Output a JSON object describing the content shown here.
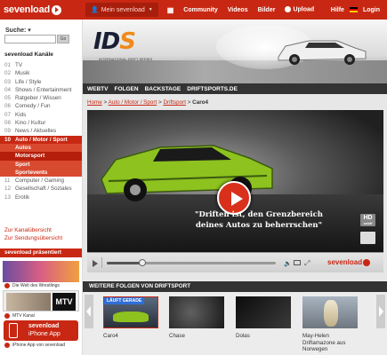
{
  "brand": {
    "name": "sevenload",
    "accent": "#c82813"
  },
  "topnav": {
    "mein": "Mein sevenload",
    "items": [
      "Community",
      "Videos",
      "Bilder"
    ],
    "upload": "Upload",
    "hilfe": "Hilfe",
    "login": "Login"
  },
  "sidebar": {
    "search_label": "Suche",
    "search_value": "",
    "search_button": "Go",
    "kanaele_title": "sevenload Kanäle",
    "categories": [
      {
        "num": "01",
        "label": "TV"
      },
      {
        "num": "02",
        "label": "Musik"
      },
      {
        "num": "03",
        "label": "Life / Style"
      },
      {
        "num": "04",
        "label": "Shows / Entertainment"
      },
      {
        "num": "05",
        "label": "Ratgeber / Wissen"
      },
      {
        "num": "06",
        "label": "Comedy / Fun"
      },
      {
        "num": "07",
        "label": "Kids"
      },
      {
        "num": "08",
        "label": "Kino / Kultur"
      },
      {
        "num": "09",
        "label": "News / Aktuelles"
      },
      {
        "num": "10",
        "label": "Auto / Motor / Sport"
      }
    ],
    "subcategories": [
      "Autos",
      "Motorsport",
      "Sport",
      "Sportevents"
    ],
    "categories2": [
      {
        "num": "11",
        "label": "Computer / Gaming"
      },
      {
        "num": "12",
        "label": "Gesellschaft / Soziales"
      },
      {
        "num": "13",
        "label": "Erotik"
      }
    ],
    "links": [
      "Zur Kanalübersicht",
      "Zur Sendungsübersicht"
    ],
    "praesentiert": "sevenload präsentiert",
    "promo1_caption": "Die Welt des Wrestlings",
    "promo2_logo": "MTV",
    "promo2_caption": "MTV Kanal",
    "iphone_line1": "sevenload",
    "iphone_line2": "iPhone App",
    "iphone_caption": "iPhone App von sevenload"
  },
  "banner": {
    "logo_main": "ID",
    "logo_accent": "S",
    "logo_sub": "INTERNATIONAL DRIFT SERIES"
  },
  "subnav": [
    "WEBTV",
    "FOLGEN",
    "BACKSTAGE",
    "DRIFTSPORTS.DE"
  ],
  "breadcrumb": {
    "items": [
      "Home",
      "Auto / Motor / Sport",
      "Driftsport"
    ],
    "current": "Caro4",
    "sep": ">"
  },
  "player": {
    "quote_line1": "\"Driften ist, den Grenzbereich",
    "quote_line2": "deines Autos zu beherrschen\"",
    "hd_label": "HD",
    "hd_sub": "on/off",
    "cc_label": "",
    "progress_loaded": 0.2,
    "logo": "sevenload"
  },
  "more": {
    "title": "WEITERE FOLGEN VON DRIFTSPORT",
    "live_badge": "LÄUFT GERADE",
    "episodes": [
      "Caro4",
      "Chase",
      "Dolas",
      "May-Helen Driftamazone aus Norwegen"
    ]
  }
}
